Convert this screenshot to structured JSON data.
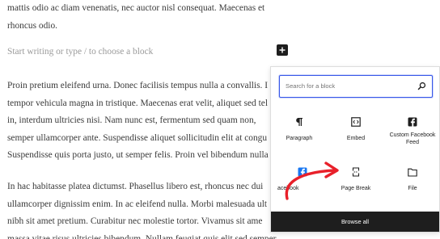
{
  "editor": {
    "para_top": [
      "mattis odio ac diam venenatis, nec auctor nisl consequat. Maecenas et",
      "rhoncus odio."
    ],
    "placeholder": "Start writing or type / to choose a block",
    "para_mid": [
      "Proin pretium eleifend urna. Donec facilisis tempus nulla a convallis. I",
      "tempor vehicula magna in tristique. Maecenas erat velit, aliquet sed tel",
      "in, interdum ultricies nisi. Nam nunc est, fermentum sed quam non,",
      "semper ullamcorper ante. Suspendisse aliquet sollicitudin elit at congu",
      "Suspendisse quis porta justo, ut semper felis. Proin vel bibendum nulla"
    ],
    "para_bot": [
      "In hac habitasse platea dictumst. Phasellus libero est, rhoncus nec dui",
      "ullamcorper dignissim enim. In ac eleifend nulla. Morbi malesuada ult",
      "nibh sit amet pretium. Curabitur nec molestie tortor. Vivamus sit ame",
      "massa vitae risus ultricies bibendum. Nullam feugiat quis elit sed semper."
    ]
  },
  "inserter": {
    "search_placeholder": "Search for a block",
    "blocks": [
      {
        "label": "Paragraph",
        "icon": "paragraph-icon"
      },
      {
        "label": "Embed",
        "icon": "embed-icon"
      },
      {
        "label": "Custom Facebook Feed",
        "icon": "facebook-icon"
      },
      {
        "label": "acebook",
        "icon": "facebook-icon"
      },
      {
        "label": "Page Break",
        "icon": "page-break-icon"
      },
      {
        "label": "File",
        "icon": "folder-icon"
      }
    ],
    "browse_all": "Browse all"
  },
  "colors": {
    "accent": "#3858e9",
    "dark": "#1e1e1e",
    "arrow": "#e8202a",
    "facebook": "#1877f2"
  }
}
